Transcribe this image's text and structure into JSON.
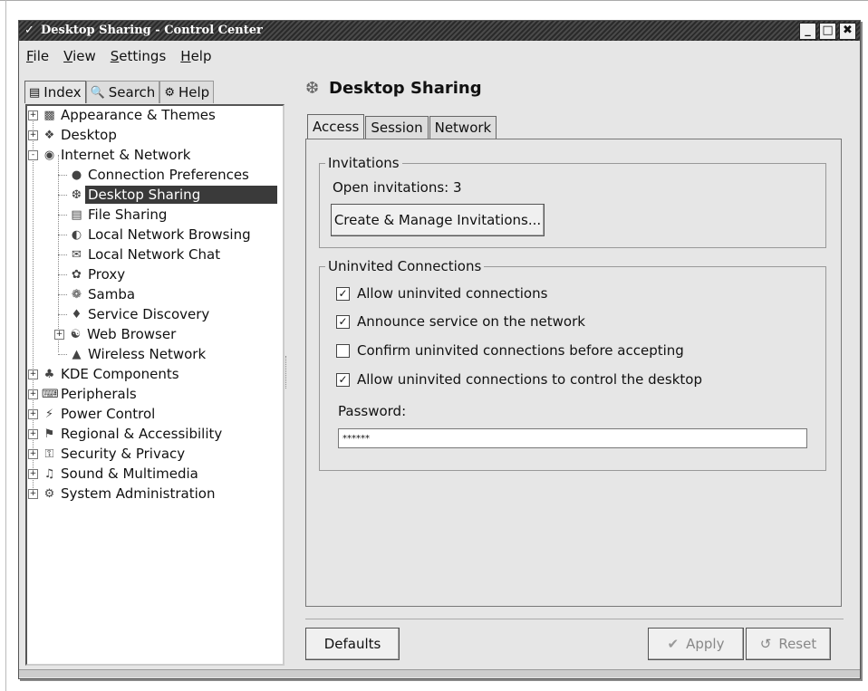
{
  "window": {
    "title": "Desktop Sharing - Control Center",
    "buttons": [
      "_",
      "□",
      "✖"
    ]
  },
  "menubar": {
    "items": [
      "File",
      "View",
      "Settings",
      "Help"
    ]
  },
  "sidebar_tabs": [
    {
      "label": "Index",
      "icon": "index-icon"
    },
    {
      "label": "Search",
      "icon": "search-icon"
    },
    {
      "label": "Help",
      "icon": "help-icon"
    }
  ],
  "tree": [
    {
      "label": "Appearance & Themes",
      "icon": "appearance-icon",
      "level": 0,
      "expand": "+"
    },
    {
      "label": "Desktop",
      "icon": "desktop-icon",
      "level": 0,
      "expand": "+"
    },
    {
      "label": "Internet & Network",
      "icon": "globe-icon",
      "level": 0,
      "expand": "-"
    },
    {
      "label": "Connection Preferences",
      "icon": "connection-icon",
      "level": 1
    },
    {
      "label": "Desktop Sharing",
      "icon": "desktop-sharing-icon",
      "level": 1,
      "selected": true
    },
    {
      "label": "File Sharing",
      "icon": "folder-icon",
      "level": 1
    },
    {
      "label": "Local Network Browsing",
      "icon": "network-browse-icon",
      "level": 1
    },
    {
      "label": "Local Network Chat",
      "icon": "chat-icon",
      "level": 1
    },
    {
      "label": "Proxy",
      "icon": "proxy-icon",
      "level": 1
    },
    {
      "label": "Samba",
      "icon": "samba-icon",
      "level": 1
    },
    {
      "label": "Service Discovery",
      "icon": "service-discovery-icon",
      "level": 1
    },
    {
      "label": "Web Browser",
      "icon": "web-browser-icon",
      "level": 1,
      "expand": "+"
    },
    {
      "label": "Wireless Network",
      "icon": "wireless-icon",
      "level": 1
    },
    {
      "label": "KDE Components",
      "icon": "kde-components-icon",
      "level": 0,
      "expand": "+"
    },
    {
      "label": "Peripherals",
      "icon": "peripherals-icon",
      "level": 0,
      "expand": "+"
    },
    {
      "label": "Power Control",
      "icon": "power-icon",
      "level": 0,
      "expand": "+"
    },
    {
      "label": "Regional & Accessibility",
      "icon": "regional-icon",
      "level": 0,
      "expand": "+"
    },
    {
      "label": "Security & Privacy",
      "icon": "security-icon",
      "level": 0,
      "expand": "+"
    },
    {
      "label": "Sound & Multimedia",
      "icon": "sound-icon",
      "level": 0,
      "expand": "+"
    },
    {
      "label": "System Administration",
      "icon": "system-admin-icon",
      "level": 0,
      "expand": "+"
    }
  ],
  "panel": {
    "title": "Desktop Sharing",
    "tabs": [
      "Access",
      "Session",
      "Network"
    ],
    "invitations": {
      "legend": "Invitations",
      "open_text": "Open invitations: 3",
      "manage_button": "Create & Manage Invitations..."
    },
    "uninvited": {
      "legend": "Uninvited Connections",
      "checkboxes": [
        {
          "label": "Allow uninvited connections",
          "checked": true
        },
        {
          "label": "Announce service on the network",
          "checked": true
        },
        {
          "label": "Confirm uninvited connections before accepting",
          "checked": false
        },
        {
          "label": "Allow uninvited connections to control the desktop",
          "checked": true
        }
      ],
      "password_label": "Password:",
      "password_value": "******"
    }
  },
  "buttons": {
    "defaults": "Defaults",
    "apply": "Apply",
    "reset": "Reset"
  }
}
